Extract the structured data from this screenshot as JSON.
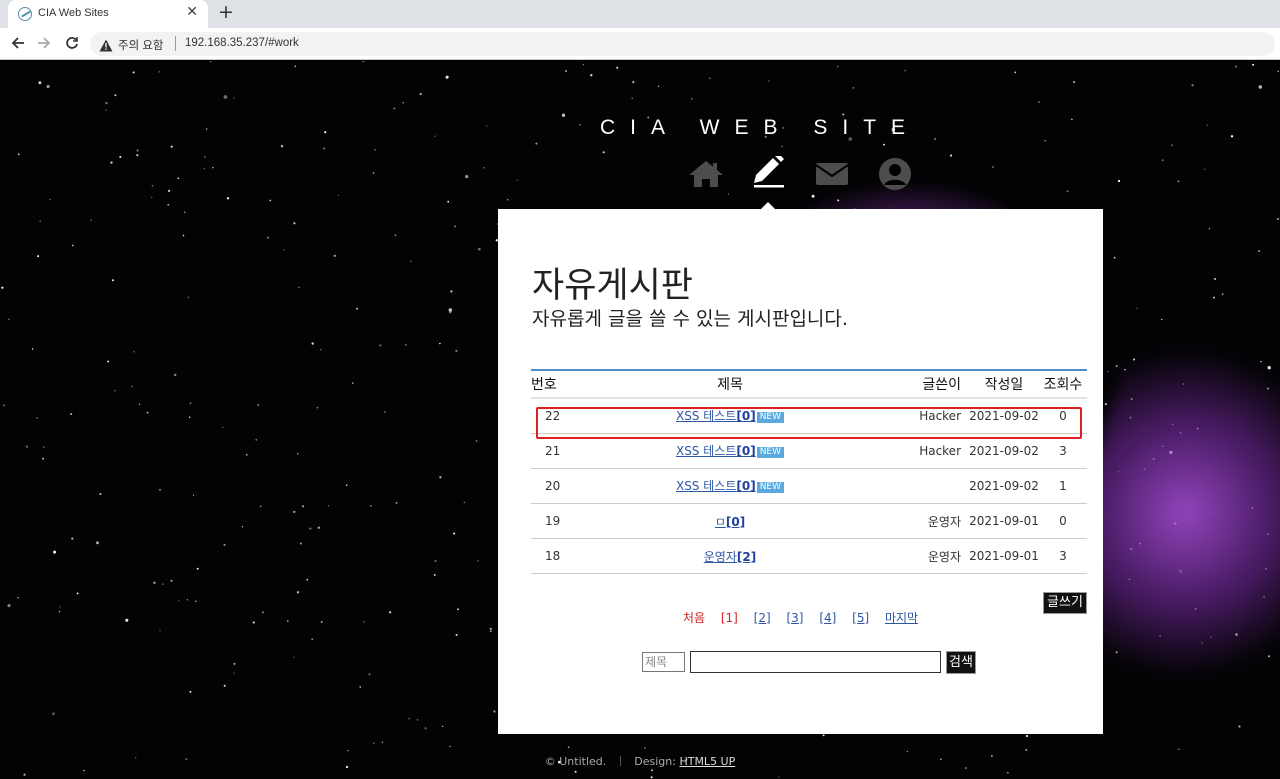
{
  "browser": {
    "tab_title": "CIA Web Sites",
    "security_label": "주의 요함",
    "url": "192.168.35.237/#work"
  },
  "site": {
    "title": "CIA WEB SITE",
    "nav": [
      "home-icon",
      "pencil-icon",
      "envelope-icon",
      "user-icon"
    ],
    "active_nav": "pencil-icon"
  },
  "board": {
    "heading": "자유게시판",
    "subheading": "자유롭게 글을 쓸 수 있는 게시판입니다.",
    "columns": [
      "번호",
      "제목",
      "글쓴이",
      "작성일",
      "조회수"
    ],
    "rows": [
      {
        "no": "22",
        "title": "XSS 테스트",
        "comments": "[0]",
        "new": "NEW",
        "author": "Hacker",
        "date": "2021-09-02",
        "views": "0"
      },
      {
        "no": "21",
        "title": "XSS 테스트",
        "comments": "[0]",
        "new": "NEW",
        "author": "Hacker",
        "date": "2021-09-02",
        "views": "3"
      },
      {
        "no": "20",
        "title": "XSS 테스트",
        "comments": "[0]",
        "new": "NEW",
        "author": "",
        "date": "2021-09-02",
        "views": "1"
      },
      {
        "no": "19",
        "title": "ㅁ",
        "comments": "[0]",
        "new": "",
        "author": "운영자",
        "date": "2021-09-01",
        "views": "0"
      },
      {
        "no": "18",
        "title": "운영자",
        "comments": "[2]",
        "new": "",
        "author": "운영자",
        "date": "2021-09-01",
        "views": "3"
      }
    ],
    "write_button": "글쓰기",
    "pagination": {
      "first": "처음",
      "current": "[1]",
      "pages": [
        "[2]",
        "[3]",
        "[4]",
        "[5]"
      ],
      "last": "마지막"
    },
    "search": {
      "field": "제목",
      "value": "",
      "button": "검색"
    },
    "highlight_color": "#e02020"
  },
  "footer": {
    "copyright": "© Untitled.",
    "design_label": "Design:",
    "design_link": "HTML5 UP"
  }
}
